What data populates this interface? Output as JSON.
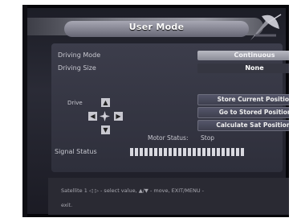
{
  "header": {
    "title": "User Mode"
  },
  "settings": [
    {
      "label": "Driving Mode",
      "value": "Continuous"
    },
    {
      "label": "Driving Size",
      "value": "None"
    }
  ],
  "drive": {
    "label": "Drive",
    "up_icon": "arrow-up-icon",
    "down_icon": "arrow-down-icon",
    "left_icon": "arrow-left-icon",
    "right_icon": "arrow-right-icon"
  },
  "buttons": [
    {
      "label": "Store Current Position"
    },
    {
      "label": "Go to Stored Position"
    },
    {
      "label": "Calculate Sat Positions"
    }
  ],
  "motor": {
    "label": "Motor Status:",
    "value": "Stop"
  },
  "signal": {
    "label": "Signal Status",
    "bars": 24
  },
  "help": {
    "line1": "Satellite 1  ◁ ▷ - select value, ▲/▼ - move, EXIT/MENU -",
    "line2": "exit."
  },
  "colors": {
    "highlight": "#b8b9c2",
    "panel": "#353641",
    "signal_bar": "#d9d9e0"
  }
}
